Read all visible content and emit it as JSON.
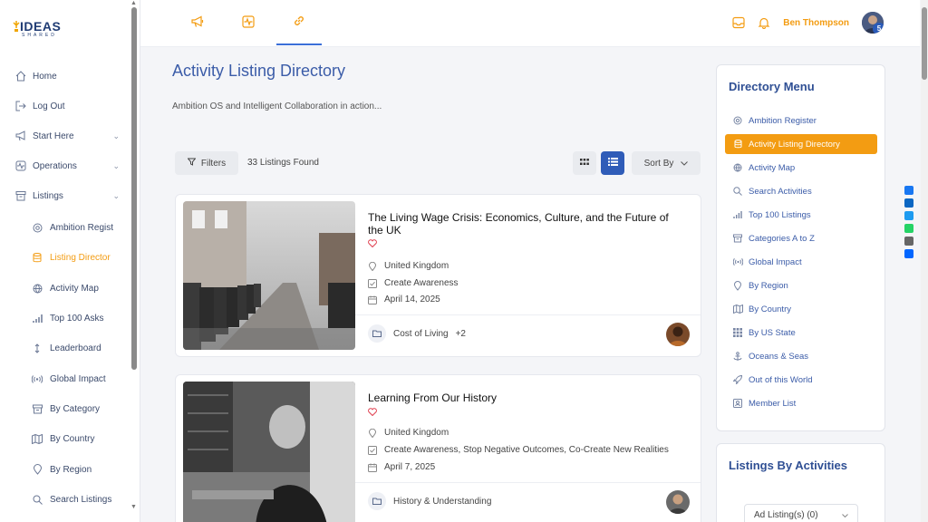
{
  "logo": {
    "word": "IDEAS",
    "sub": "SHARED"
  },
  "sidebar": {
    "items": [
      {
        "label": "Home",
        "icon": "home-icon"
      },
      {
        "label": "Log Out",
        "icon": "logout-icon"
      },
      {
        "label": "Start Here",
        "icon": "megaphone-icon"
      },
      {
        "label": "Operations",
        "icon": "pulse-icon"
      },
      {
        "label": "Listings",
        "icon": "archive-icon"
      }
    ],
    "sub_items": [
      {
        "label": "Ambition Regist",
        "icon": "gear-icon"
      },
      {
        "label": "Listing Director",
        "icon": "database-icon"
      },
      {
        "label": "Activity Map",
        "icon": "globe-icon"
      },
      {
        "label": "Top 100 Asks",
        "icon": "bar-chart-icon"
      },
      {
        "label": "Leaderboard",
        "icon": "updown-icon"
      },
      {
        "label": "Global Impact",
        "icon": "broadcast-icon"
      },
      {
        "label": "By Category",
        "icon": "archive-icon"
      },
      {
        "label": "By Country",
        "icon": "map-icon"
      },
      {
        "label": "By Region",
        "icon": "pin-icon"
      },
      {
        "label": "Search Listings",
        "icon": "search-icon"
      }
    ]
  },
  "header": {
    "user_name": "Ben Thompson",
    "avatar_badge": "5"
  },
  "main": {
    "title": "Activity Listing Directory",
    "subtitle": "Ambition OS and Intelligent Collaboration in action...",
    "filters_label": "Filters",
    "found_label": "33 Listings Found",
    "sort_label": "Sort By"
  },
  "listings": [
    {
      "title": "The Living Wage Crisis: Economics, Culture, and the Future of the UK",
      "location": "United Kingdom",
      "purpose": "Create Awareness",
      "date": "April 14, 2025",
      "category": "Cost of Living",
      "more": "+2"
    },
    {
      "title": "Learning From Our History",
      "location": "United Kingdom",
      "purpose": "Create Awareness, Stop Negative Outcomes, Co-Create New Realities",
      "date": "April 7, 2025",
      "category": "History & Understanding",
      "more": ""
    }
  ],
  "directory_menu": {
    "title": "Directory Menu",
    "items": [
      {
        "label": "Ambition Register",
        "icon": "gear-icon"
      },
      {
        "label": "Activity Listing Directory",
        "icon": "database-icon"
      },
      {
        "label": "Activity Map",
        "icon": "globe-icon"
      },
      {
        "label": "Search Activities",
        "icon": "search-icon"
      },
      {
        "label": "Top 100 Listings",
        "icon": "bar-chart-icon"
      },
      {
        "label": "Categories A to Z",
        "icon": "archive-icon"
      },
      {
        "label": "Global Impact",
        "icon": "broadcast-icon"
      },
      {
        "label": "By Region",
        "icon": "pin-icon"
      },
      {
        "label": "By Country",
        "icon": "map-icon"
      },
      {
        "label": "By US State",
        "icon": "grid-icon"
      },
      {
        "label": "Oceans & Seas",
        "icon": "anchor-icon"
      },
      {
        "label": "Out of this World",
        "icon": "rocket-icon"
      },
      {
        "label": "Member List",
        "icon": "id-card-icon"
      }
    ]
  },
  "activities_panel": {
    "title": "Listings By Activities",
    "select_value": "Ad Listing(s) (0)"
  },
  "colors": {
    "accent": "#f39c12",
    "primary": "#2f5cb8",
    "title": "#3b5ca8"
  }
}
